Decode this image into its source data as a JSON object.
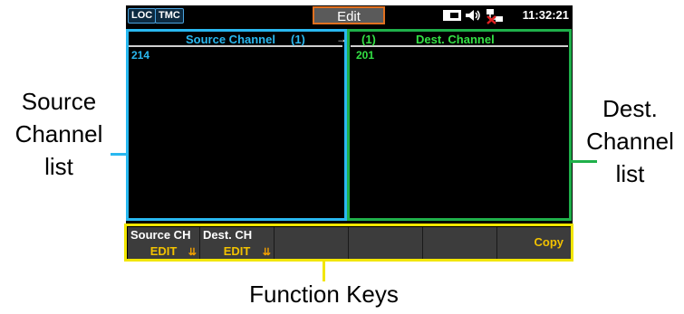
{
  "status_bar": {
    "loc_label": "LOC",
    "tmc_label": "TMC",
    "mode_tab": "Edit",
    "time": "11:32:21"
  },
  "source_panel": {
    "title": "Source Channel",
    "count": "(1)",
    "items": [
      "214"
    ]
  },
  "dest_panel": {
    "title": "Dest. Channel",
    "count": "(1)",
    "items": [
      "201"
    ]
  },
  "function_keys": [
    {
      "line1": "Source CH",
      "line2": "EDIT"
    },
    {
      "line1": "Dest. CH",
      "line2": "EDIT"
    },
    {
      "line1": "",
      "line2": ""
    },
    {
      "line1": "",
      "line2": ""
    },
    {
      "line1": "",
      "line2": ""
    },
    {
      "line1": "Copy",
      "line2": ""
    }
  ],
  "callouts": {
    "source_list": [
      "Source",
      "Channel",
      "list"
    ],
    "dest_list": [
      "Dest.",
      "Channel",
      "list"
    ],
    "function_keys": "Function Keys"
  },
  "colors": {
    "source_accent": "#29b8f0",
    "dest_accent": "#1fb04a",
    "function_key_accent": "#f2e600",
    "edit_tab_border": "#e07020"
  },
  "icons": [
    "storage-icon",
    "speaker-icon",
    "network-disconnected-icon",
    "double-chevron-down-icon"
  ]
}
